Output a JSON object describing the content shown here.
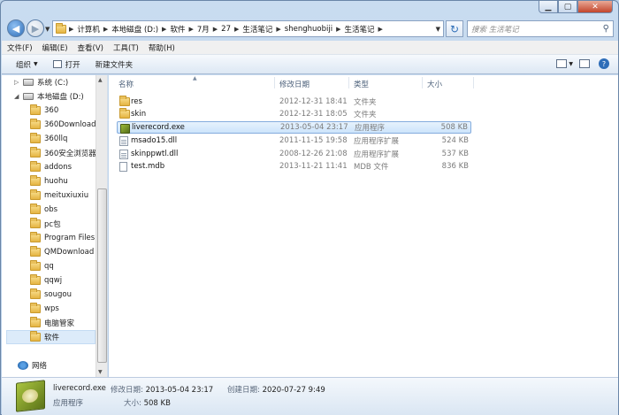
{
  "window": {
    "caption_buttons": [
      "minimize",
      "maximize",
      "close"
    ]
  },
  "address_bar": {
    "crumbs": [
      "计算机",
      "本地磁盘 (D:)",
      "软件",
      "7月",
      "27",
      "生活笔记",
      "shenghuobiji",
      "生活笔记"
    ]
  },
  "search": {
    "placeholder": "搜索 生活笔记"
  },
  "menu": [
    "文件(F)",
    "编辑(E)",
    "查看(V)",
    "工具(T)",
    "帮助(H)"
  ],
  "toolbar": {
    "organize": "组织",
    "open": "打开",
    "new_folder": "新建文件夹"
  },
  "navigation": {
    "drives": [
      {
        "label": "系统 (C:)"
      },
      {
        "label": "本地磁盘 (D:)"
      }
    ],
    "folders": [
      "360",
      "360Downloads",
      "360llq",
      "360安全浏览器",
      "addons",
      "huohu",
      "meituxiuxiu",
      "obs",
      "pc包",
      "Program Files",
      "QMDownload",
      "qq",
      "qqwj",
      "sougou",
      "wps",
      "电脑管家",
      "软件"
    ],
    "selected": "软件",
    "network": "网络"
  },
  "file_list": {
    "columns": {
      "name": "名称",
      "date": "修改日期",
      "type": "类型",
      "size": "大小"
    },
    "rows": [
      {
        "name": "res",
        "date": "2012-12-31 18:41",
        "type": "文件夹",
        "size": "",
        "icon": "folder-icon"
      },
      {
        "name": "skin",
        "date": "2012-12-31 18:05",
        "type": "文件夹",
        "size": "",
        "icon": "folder-icon"
      },
      {
        "name": "liverecord.exe",
        "date": "2013-05-04 23:17",
        "type": "应用程序",
        "size": "508 KB",
        "icon": "exe-icon",
        "selected": true
      },
      {
        "name": "msado15.dll",
        "date": "2011-11-15 19:58",
        "type": "应用程序扩展",
        "size": "524 KB",
        "icon": "dll-icon"
      },
      {
        "name": "skinppwtl.dll",
        "date": "2008-12-26 21:08",
        "type": "应用程序扩展",
        "size": "537 KB",
        "icon": "dll-icon"
      },
      {
        "name": "test.mdb",
        "date": "2013-11-21 11:41",
        "type": "MDB 文件",
        "size": "836 KB",
        "icon": "file-icon"
      }
    ]
  },
  "details": {
    "name": "liverecord.exe",
    "type": "应用程序",
    "modified_label": "修改日期:",
    "modified": "2013-05-04 23:17",
    "size_label": "大小:",
    "size": "508 KB",
    "created_label": "创建日期:",
    "created": "2020-07-27 9:49"
  }
}
